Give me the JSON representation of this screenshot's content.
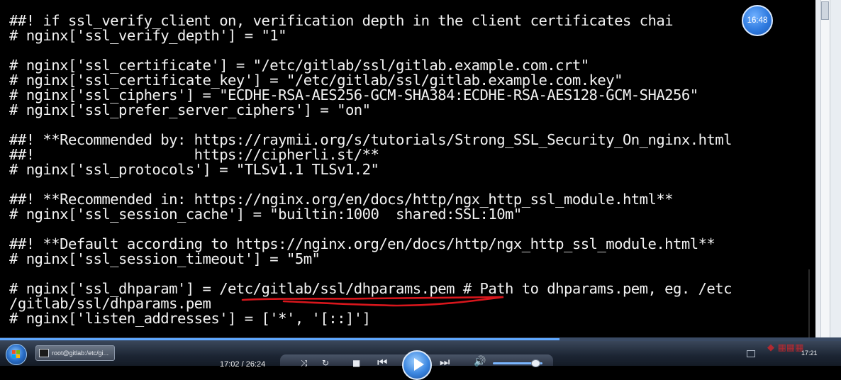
{
  "terminal": {
    "lines": [
      "##! if ssl_verify_client on, verification depth in the client certificates chai",
      "# nginx['ssl_verify_depth'] = \"1\"",
      "",
      "# nginx['ssl_certificate'] = \"/etc/gitlab/ssl/gitlab.example.com.crt\"",
      "# nginx['ssl_certificate_key'] = \"/etc/gitlab/ssl/gitlab.example.com.key\"",
      "# nginx['ssl_ciphers'] = \"ECDHE-RSA-AES256-GCM-SHA384:ECDHE-RSA-AES128-GCM-SHA256\"",
      "# nginx['ssl_prefer_server_ciphers'] = \"on\"",
      "",
      "##! **Recommended by: https://raymii.org/s/tutorials/Strong_SSL_Security_On_nginx.html",
      "##!                   https://cipherli.st/**",
      "# nginx['ssl_protocols'] = \"TLSv1.1 TLSv1.2\"",
      "",
      "##! **Recommended in: https://nginx.org/en/docs/http/ngx_http_ssl_module.html**",
      "# nginx['ssl_session_cache'] = \"builtin:1000  shared:SSL:10m\"",
      "",
      "##! **Default according to https://nginx.org/en/docs/http/ngx_http_ssl_module.html**",
      "# nginx['ssl_session_timeout'] = \"5m\"",
      "",
      "# nginx['ssl_dhparam'] = /etc/gitlab/ssl/dhparams.pem # Path to dhparams.pem, eg. /etc",
      "/gitlab/ssl/dhparams.pem",
      "# nginx['listen_addresses'] = ['*', '[::]']"
    ]
  },
  "overlay": {
    "clock": "16:48",
    "underline_color": "#d8161c"
  },
  "taskbar": {
    "task_label": "root@gitlab:/etc/gi...",
    "clock": "17:21"
  },
  "player": {
    "time": "17:02 / 26:24",
    "progress": 0.665,
    "volume": 0.85,
    "accent": "#3b86e0"
  }
}
